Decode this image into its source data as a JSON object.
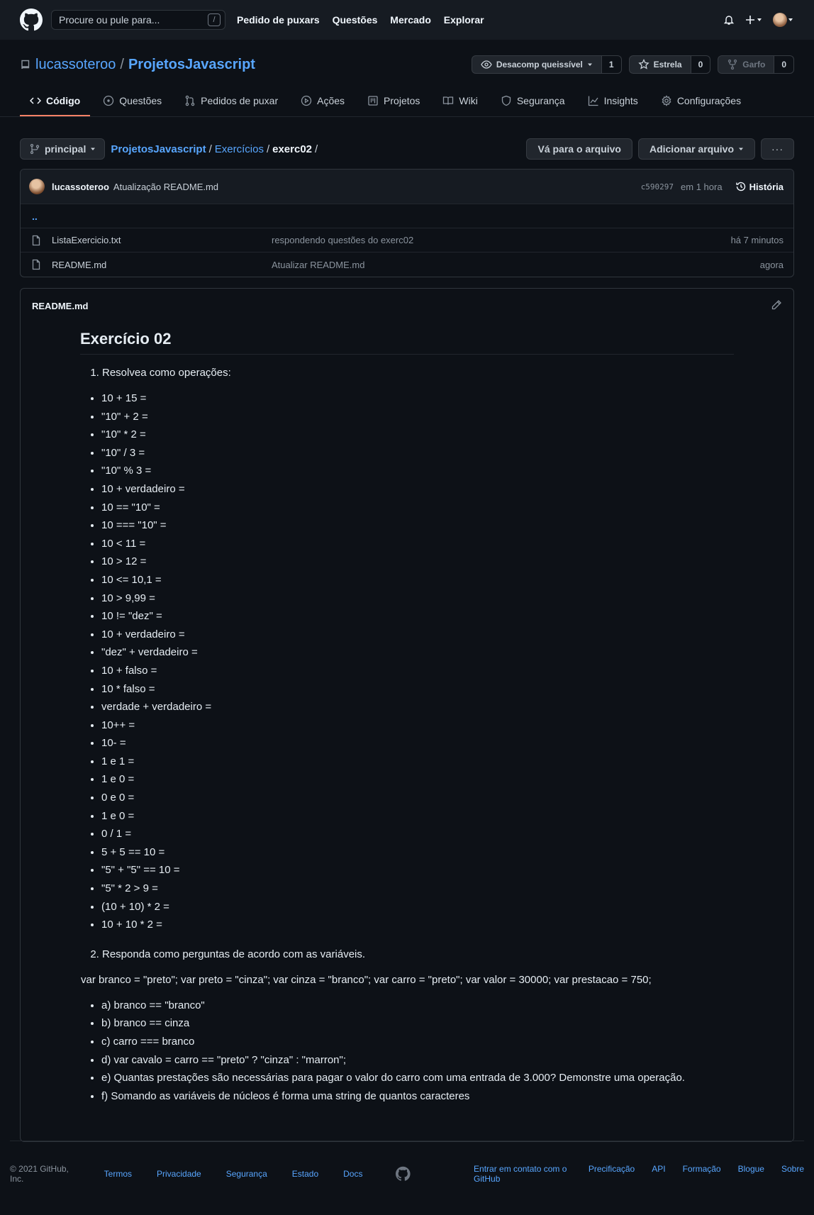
{
  "header": {
    "search_placeholder": "Procure ou pule para...",
    "search_key": "/",
    "nav": [
      "Pedido de puxars",
      "Questões",
      "Mercado",
      "Explorar"
    ]
  },
  "repo": {
    "owner": "lucassoteroo",
    "separator": "/",
    "name": "ProjetosJavascript",
    "watch_label": "Desacomp queissível",
    "watch_count": "1",
    "star_label": "Estrela",
    "star_count": "0",
    "fork_label": "Garfo",
    "fork_count": "0"
  },
  "tabs": [
    {
      "label": "Código",
      "icon": "code-icon"
    },
    {
      "label": "Questões",
      "icon": "issue-icon"
    },
    {
      "label": "Pedidos de puxar",
      "icon": "pull-request-icon"
    },
    {
      "label": "Ações",
      "icon": "play-icon"
    },
    {
      "label": "Projetos",
      "icon": "project-icon"
    },
    {
      "label": "Wiki",
      "icon": "book-icon"
    },
    {
      "label": "Segurança",
      "icon": "shield-icon"
    },
    {
      "label": "Insights",
      "icon": "graph-icon"
    },
    {
      "label": "Configurações",
      "icon": "gear-icon"
    }
  ],
  "filenav": {
    "branch": "principal",
    "crumb_root": "ProjetosJavascript",
    "crumb_dir": "Exercícios",
    "crumb_current": "exerc02",
    "goto_file": "Vá para o arquivo",
    "add_file": "Adicionar arquivo",
    "more": "···"
  },
  "commit": {
    "author": "lucassoteroo",
    "message": "Atualização README.md",
    "sha": "c590297",
    "time": "em 1 hora",
    "history": "História"
  },
  "files": {
    "updir": "..",
    "rows": [
      {
        "name": "ListaExercicio.txt",
        "message": "respondendo questões do exerc02",
        "age": "há 7 minutos"
      },
      {
        "name": "README.md",
        "message": "Atualizar README.md",
        "age": "agora"
      }
    ]
  },
  "readme": {
    "filename": "README.md",
    "title": "Exercício 02",
    "q1": "Resolvea como operações:",
    "ops": [
      "10 + 15 =",
      "\"10\" + 2 =",
      "\"10\" * 2 =",
      "\"10\" / 3 =",
      "\"10\" % 3 =",
      "10 + verdadeiro =",
      "10 == \"10\" =",
      "10 === \"10\" =",
      "10 < 11 =",
      "10 > 12 =",
      "10 <= 10,1 =",
      "10 > 9,99 =",
      "10 != \"dez\" =",
      "10 + verdadeiro =",
      "\"dez\" + verdadeiro =",
      "10 + falso =",
      "10 * falso =",
      "verdade + verdadeiro =",
      "10++ =",
      "10- =",
      "1 e 1 =",
      "1 e 0 =",
      "0 e 0 =",
      "1 e 0 =",
      "0 / 1 =",
      "5 + 5 == 10 =",
      "\"5\" + \"5\" == 10 =",
      "\"5\" * 2 > 9 =",
      "(10 + 10) * 2 =",
      "10 + 10 * 2 ="
    ],
    "q2": "Responda como perguntas de acordo com as variáveis.",
    "vars": "var branco = \"preto\"; var preto = \"cinza\"; var cinza = \"branco\"; var carro = \"preto\"; var valor = 30000; var prestacao = 750;",
    "questions": [
      "a) branco == \"branco\"",
      "b) branco == cinza",
      "c) carro === branco",
      "d) var cavalo = carro == \"preto\" ? \"cinza\" : \"marron\";",
      "e) Quantas prestações são necessárias para pagar o valor do carro com uma entrada de 3.000? Demonstre uma operação.",
      "f) Somando as variáveis de núcleos é forma uma string de quantos caracteres"
    ]
  },
  "footer": {
    "copyright": "© 2021 GitHub, Inc.",
    "left_links": [
      "Termos",
      "Privacidade",
      "Segurança",
      "Estado",
      "Docs"
    ],
    "right_links": [
      "Entrar em contato com o GitHub",
      "Precificação",
      "API",
      "Formação",
      "Blogue",
      "Sobre"
    ]
  }
}
